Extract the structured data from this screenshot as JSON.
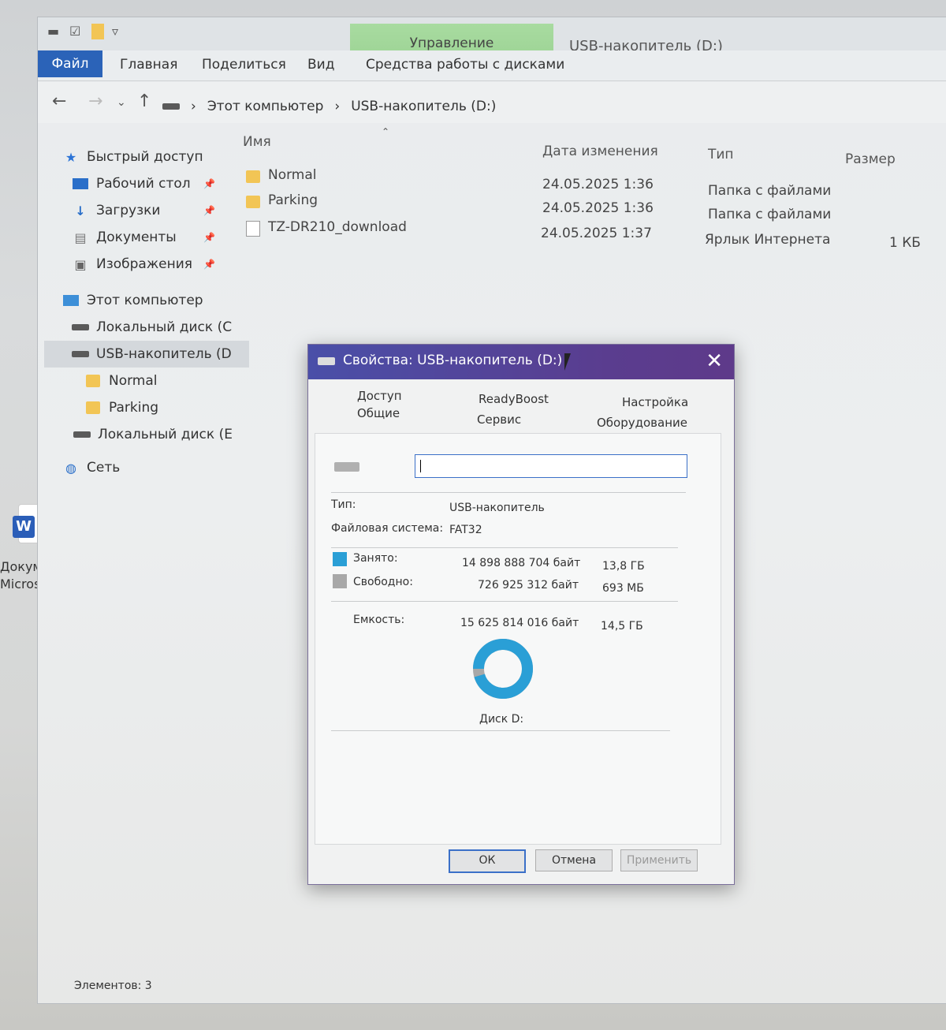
{
  "window": {
    "title": "USB-накопитель (D:)",
    "contextual_tab": "Управление"
  },
  "ribbon": {
    "file": "Файл",
    "tabs": [
      "Главная",
      "Поделиться",
      "Вид",
      "Средства работы с дисками"
    ]
  },
  "address": {
    "crumbs": [
      "Этот компьютер",
      "USB-накопитель (D:)"
    ]
  },
  "nav": {
    "items": [
      {
        "label": "Быстрый доступ",
        "icon": "star-icon",
        "pinned": false
      },
      {
        "label": "Рабочий стол",
        "icon": "desktop-icon",
        "pinned": true
      },
      {
        "label": "Загрузки",
        "icon": "download-icon",
        "pinned": true
      },
      {
        "label": "Документы",
        "icon": "documents-icon",
        "pinned": true
      },
      {
        "label": "Изображения",
        "icon": "pictures-icon",
        "pinned": true
      },
      {
        "label": "Этот компьютер",
        "icon": "computer-icon",
        "pinned": false
      },
      {
        "label": "Локальный диск (C",
        "icon": "drive-icon",
        "pinned": false
      },
      {
        "label": "USB-накопитель (D",
        "icon": "usb-drive-icon",
        "pinned": false
      },
      {
        "label": "Normal",
        "icon": "folder-icon",
        "pinned": false
      },
      {
        "label": "Parking",
        "icon": "folder-icon",
        "pinned": false
      },
      {
        "label": "Локальный диск (E",
        "icon": "drive-icon",
        "pinned": false
      },
      {
        "label": "Сеть",
        "icon": "network-icon",
        "pinned": false
      }
    ]
  },
  "list": {
    "headers": {
      "name": "Имя",
      "date": "Дата изменения",
      "type": "Тип",
      "size": "Размер"
    },
    "rows": [
      {
        "name": "Normal",
        "date": "24.05.2025 1:36",
        "type": "Папка с файлами",
        "size": ""
      },
      {
        "name": "Parking",
        "date": "24.05.2025 1:36",
        "type": "Папка с файлами",
        "size": ""
      },
      {
        "name": "TZ-DR210_download",
        "date": "24.05.2025 1:37",
        "type": "Ярлык Интернета",
        "size": "1 КБ"
      }
    ]
  },
  "status": "Элементов: 3",
  "desktop": {
    "word_label_1": "Докуме",
    "word_label_2": "Micros"
  },
  "dialog": {
    "title": "Свойства: USB-накопитель (D:)",
    "tabs": {
      "access": "Доступ",
      "readyboost": "ReadyBoost",
      "customize": "Настройка",
      "general": "Общие",
      "tools": "Сервис",
      "hardware": "Оборудование"
    },
    "name_value": "",
    "type_label": "Тип:",
    "type_value": "USB-накопитель",
    "fs_label": "Файловая система:",
    "fs_value": "FAT32",
    "used_label": "Занято:",
    "used_bytes": "14 898 888 704 байт",
    "used_human": "13,8 ГБ",
    "free_label": "Свободно:",
    "free_bytes": "726 925 312 байт",
    "free_human": "693 МБ",
    "cap_label": "Емкость:",
    "cap_bytes": "15 625 814 016 байт",
    "cap_human": "14,5 ГБ",
    "disk_label": "Диск D:",
    "used_fraction": 0.9535,
    "colors": {
      "used": "#2a9fd6",
      "free": "#a8a8a8"
    },
    "buttons": {
      "ok": "ОК",
      "cancel": "Отмена",
      "apply": "Применить"
    }
  }
}
